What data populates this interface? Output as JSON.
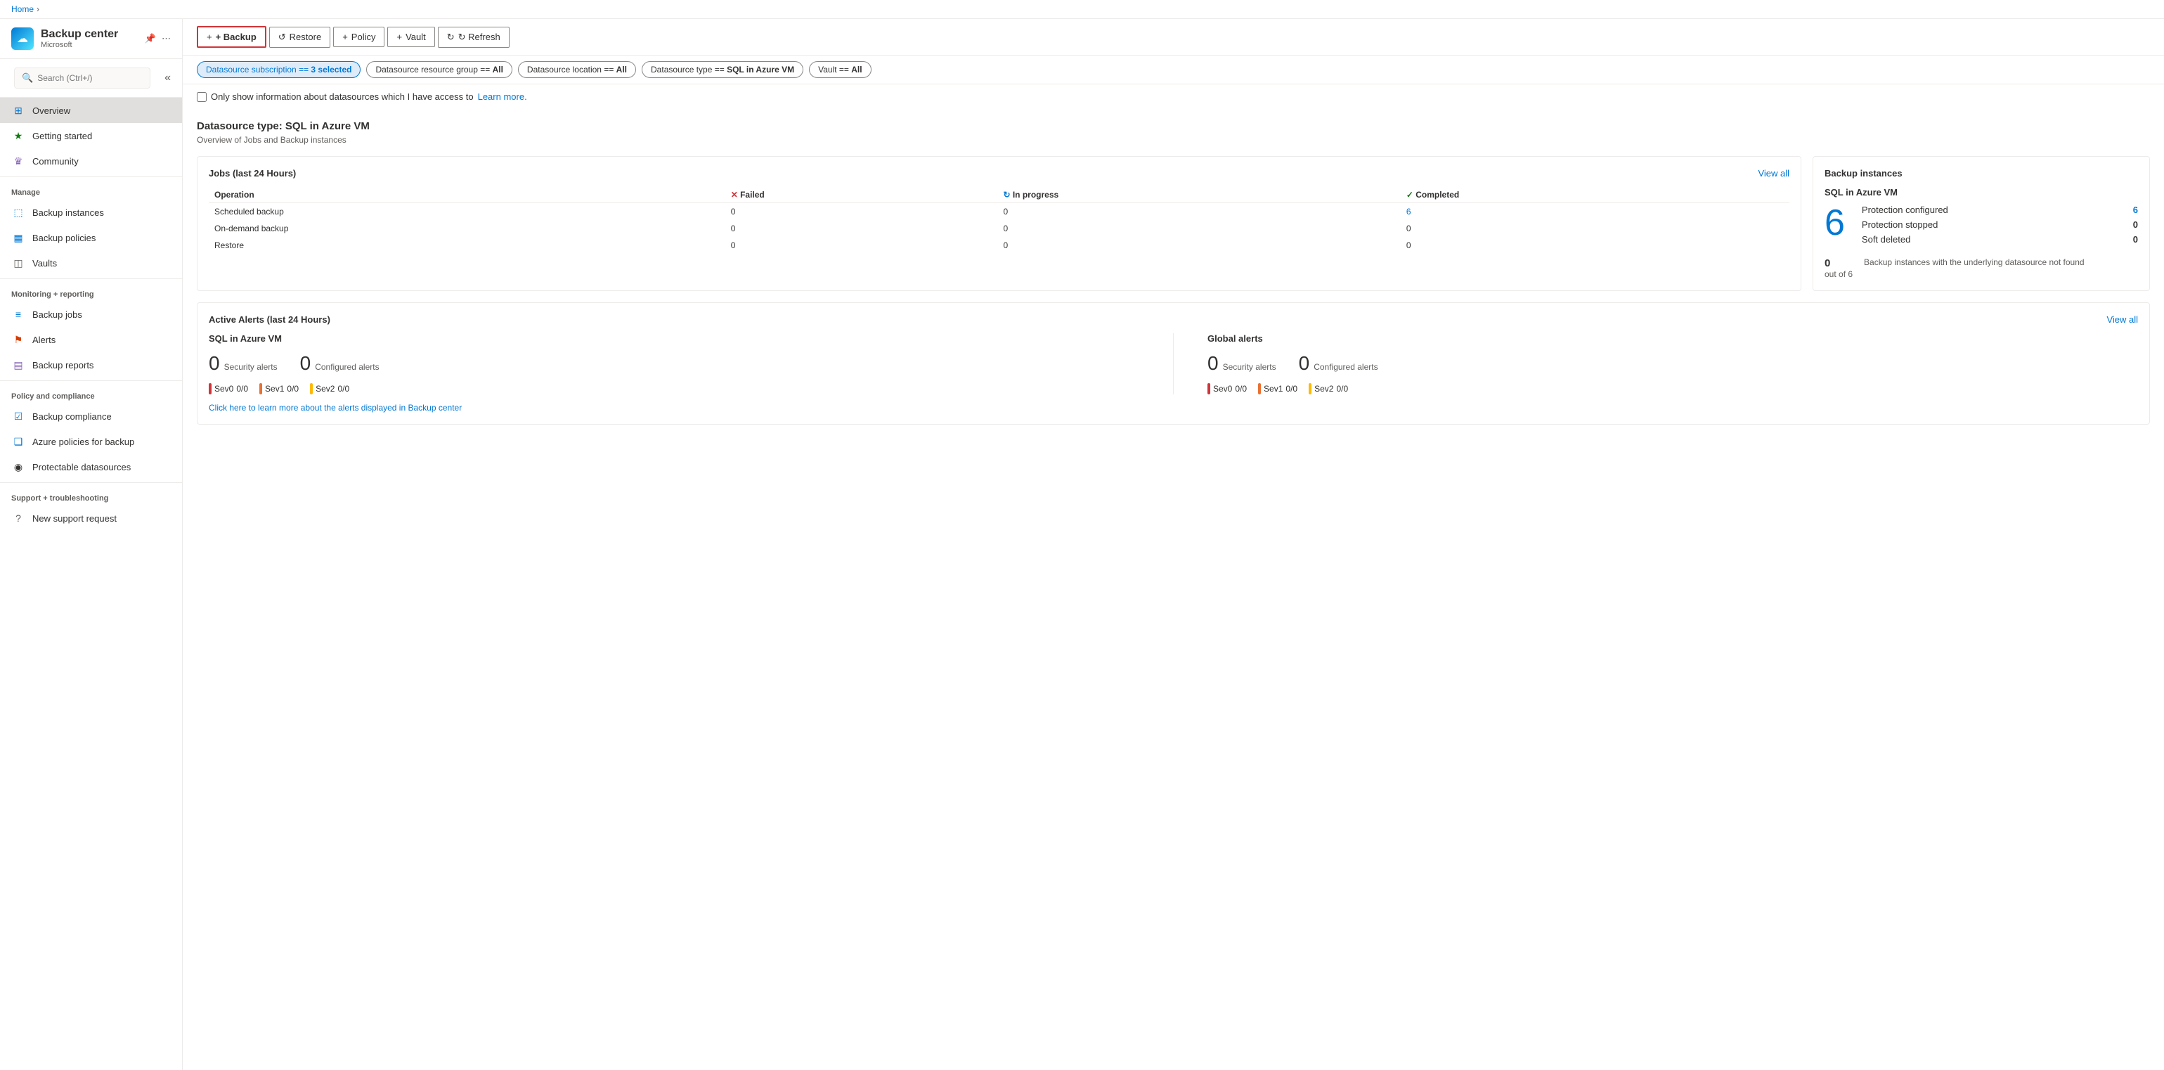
{
  "breadcrumb": {
    "home": "Home",
    "separator": "›"
  },
  "sidebar": {
    "app_name": "Backup center",
    "app_subtitle": "Microsoft",
    "search_placeholder": "Search (Ctrl+/)",
    "collapse_icon": "«",
    "nav_items": [
      {
        "id": "overview",
        "label": "Overview",
        "icon": "⊞",
        "active": true,
        "section": null
      },
      {
        "id": "getting-started",
        "label": "Getting started",
        "icon": "★",
        "active": false,
        "section": null
      },
      {
        "id": "community",
        "label": "Community",
        "icon": "♛",
        "active": false,
        "section": null
      },
      {
        "id": "manage",
        "label": "Manage",
        "section_header": true
      },
      {
        "id": "backup-instances",
        "label": "Backup instances",
        "icon": "⬚",
        "active": false,
        "section": "manage"
      },
      {
        "id": "backup-policies",
        "label": "Backup policies",
        "icon": "▦",
        "active": false,
        "section": "manage"
      },
      {
        "id": "vaults",
        "label": "Vaults",
        "icon": "◫",
        "active": false,
        "section": "manage"
      },
      {
        "id": "monitoring",
        "label": "Monitoring + reporting",
        "section_header": true
      },
      {
        "id": "backup-jobs",
        "label": "Backup jobs",
        "icon": "≡",
        "active": false,
        "section": "monitoring"
      },
      {
        "id": "alerts",
        "label": "Alerts",
        "icon": "⚑",
        "active": false,
        "section": "monitoring"
      },
      {
        "id": "backup-reports",
        "label": "Backup reports",
        "icon": "▤",
        "active": false,
        "section": "monitoring"
      },
      {
        "id": "policy-compliance",
        "label": "Policy and compliance",
        "section_header": true
      },
      {
        "id": "backup-compliance",
        "label": "Backup compliance",
        "icon": "☑",
        "active": false,
        "section": "policy"
      },
      {
        "id": "azure-policies",
        "label": "Azure policies for backup",
        "icon": "❑",
        "active": false,
        "section": "policy"
      },
      {
        "id": "protectable-datasources",
        "label": "Protectable datasources",
        "icon": "◉",
        "active": false,
        "section": "policy"
      },
      {
        "id": "support",
        "label": "Support + troubleshooting",
        "section_header": true
      },
      {
        "id": "new-support-request",
        "label": "New support request",
        "icon": "?",
        "active": false,
        "section": "support"
      }
    ]
  },
  "toolbar": {
    "backup_label": "+ Backup",
    "restore_label": "↺ Restore",
    "policy_label": "+ Policy",
    "vault_label": "+ Vault",
    "refresh_label": "↻ Refresh"
  },
  "filters": [
    {
      "id": "subscription",
      "label": "Datasource subscription == 3 selected",
      "active": true
    },
    {
      "id": "resource-group",
      "label": "Datasource resource group == All",
      "active": false
    },
    {
      "id": "location",
      "label": "Datasource location == All",
      "active": false
    },
    {
      "id": "type",
      "label": "Datasource type == SQL in Azure VM",
      "active": false
    },
    {
      "id": "vault",
      "label": "Vault == All",
      "active": false
    }
  ],
  "datasource_filter": {
    "checkbox_label": "Only show information about datasources which I have access to",
    "learn_more": "Learn more."
  },
  "content": {
    "heading": "Datasource type: SQL in Azure VM",
    "subheading": "Overview of Jobs and Backup instances"
  },
  "jobs_card": {
    "title": "Jobs (last 24 Hours)",
    "view_all": "View all",
    "columns": [
      "Operation",
      "Failed",
      "In progress",
      "Completed"
    ],
    "status_icons": {
      "failed": "✕",
      "in_progress": "↻",
      "completed": "✓"
    },
    "rows": [
      {
        "operation": "Scheduled backup",
        "failed": "0",
        "in_progress": "0",
        "completed": "6"
      },
      {
        "operation": "On-demand backup",
        "failed": "0",
        "in_progress": "0",
        "completed": "0"
      },
      {
        "operation": "Restore",
        "failed": "0",
        "in_progress": "0",
        "completed": "0"
      }
    ]
  },
  "backup_instances_card": {
    "title": "Backup instances",
    "type_label": "SQL in Azure VM",
    "big_number": "6",
    "stats": [
      {
        "label": "Protection configured",
        "value": "6",
        "is_link": true
      },
      {
        "label": "Protection stopped",
        "value": "0",
        "is_link": false
      },
      {
        "label": "Soft deleted",
        "value": "0",
        "is_link": false
      }
    ],
    "footer": {
      "num": "0",
      "out_of": "out of 6",
      "description": "Backup instances with the underlying datasource not found"
    }
  },
  "alerts_card": {
    "title": "Active Alerts (last 24 Hours)",
    "view_all": "View all",
    "sections": [
      {
        "title": "SQL in Azure VM",
        "security_alerts_num": "0",
        "security_alerts_label": "Security alerts",
        "configured_alerts_num": "0",
        "configured_alerts_label": "Configured alerts",
        "severities": [
          {
            "label": "Sev0",
            "value": "0/0",
            "color": "red"
          },
          {
            "label": "Sev1",
            "value": "0/0",
            "color": "orange"
          },
          {
            "label": "Sev2",
            "value": "0/0",
            "color": "yellow"
          }
        ]
      },
      {
        "title": "Global alerts",
        "security_alerts_num": "0",
        "security_alerts_label": "Security alerts",
        "configured_alerts_num": "0",
        "configured_alerts_label": "Configured alerts",
        "severities": [
          {
            "label": "Sev0",
            "value": "0/0",
            "color": "red"
          },
          {
            "label": "Sev1",
            "value": "0/0",
            "color": "orange"
          },
          {
            "label": "Sev2",
            "value": "0/0",
            "color": "yellow"
          }
        ]
      }
    ],
    "learn_more_text": "Click here to learn more about the alerts displayed in Backup center"
  }
}
